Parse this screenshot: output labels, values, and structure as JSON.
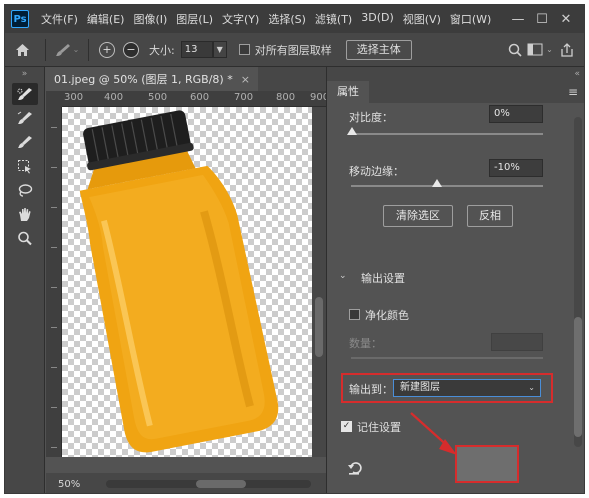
{
  "app": {
    "logo": "Ps"
  },
  "menu": [
    "文件(F)",
    "编辑(E)",
    "图像(I)",
    "图层(L)",
    "文字(Y)",
    "选择(S)",
    "滤镜(T)",
    "3D(D)",
    "视图(V)",
    "窗口(W)"
  ],
  "window_controls": {
    "minimize": "—",
    "maximize": "☐",
    "close": "✕"
  },
  "options": {
    "size_label": "大小:",
    "size_value": "13",
    "sample_all_label": "对所有图层取样",
    "select_subject": "选择主体"
  },
  "document": {
    "tab_title": "01.jpeg @ 50% (图层 1, RGB/8) *",
    "tab_close": "×",
    "ruler_ticks": [
      "300",
      "400",
      "500",
      "600",
      "700",
      "800",
      "900"
    ],
    "zoom": "50%"
  },
  "panel": {
    "tab": "属性",
    "contrast_label": "对比度：",
    "contrast_value": "0%",
    "shift_edge_label": "移动边缘：",
    "shift_edge_value": "-10%",
    "clear_selection": "清除选区",
    "invert": "反相",
    "output_settings": "输出设置",
    "decontaminate_label": "净化颜色",
    "amount_label": "数量：",
    "output_to_label": "输出到：",
    "output_to_value": "新建图层",
    "remember_label": "记住设置"
  },
  "colors": {
    "highlight": "#d62c2c",
    "accent": "#4a8ed8",
    "juice": "#f0a412",
    "cap": "#1e1e1e"
  },
  "icons": [
    "ps-logo-icon",
    "home-icon",
    "brush-icon",
    "plus-circle-icon",
    "minus-circle-icon",
    "search-icon",
    "workspace-icon",
    "share-icon",
    "reset-icon"
  ]
}
